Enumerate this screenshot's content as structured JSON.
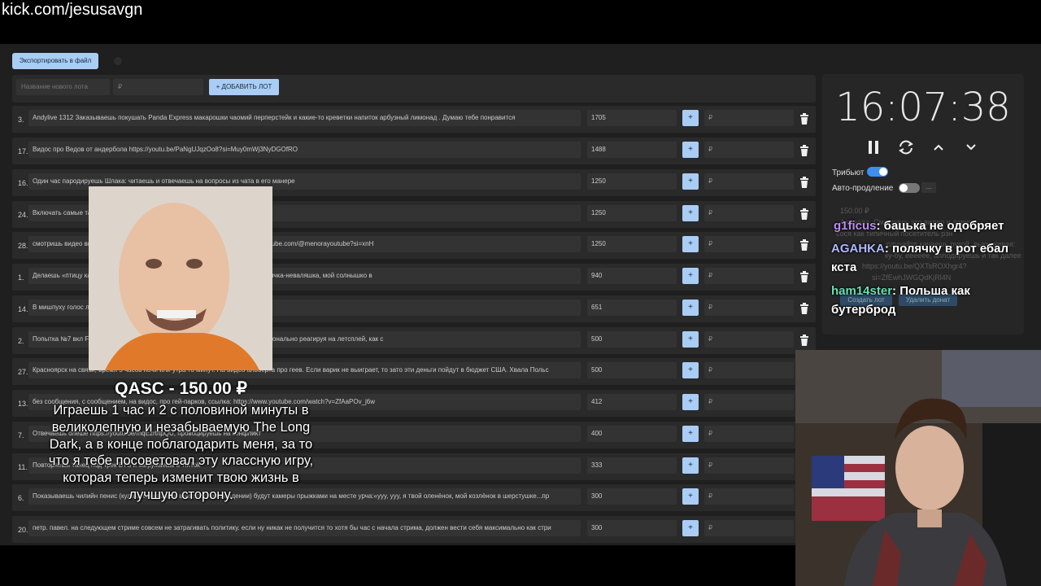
{
  "url": "kick.com/jesusavgn",
  "toolbar": {
    "export_label": "Экспортировать в файл"
  },
  "new_lot": {
    "name_placeholder": "Название нового лота",
    "amount_placeholder": "₽",
    "add_label": "+ ДОБАВИТЬ ЛОТ"
  },
  "currency": "₽",
  "lots": [
    {
      "num": "3.",
      "text": "Andylive 1312 Заказываешь покушать Panda Express макарошки чаомий перперстейк и какие-то креветки напиток арбузный лимонад . Думаю тебе понравится",
      "amount": "1705"
    },
    {
      "num": "17.",
      "text": "Видос про Ведов от андербола https://youtu.be/PaNgUJqzOo8?si=Muy0mWj3NyDGOfRO",
      "amount": "1488"
    },
    {
      "num": "16.",
      "text": "Один час пародируешь Шлака: читаешь и отвечаешь на вопросы из чата в его манере",
      "amount": "1250"
    },
    {
      "num": "24.",
      "text": "Включать самые танцевать и кайфовать",
      "amount": "1250"
    },
    {
      "num": "28.",
      "text": "смотришь видео видео если оно идет больше 30 минут. Вот ссылка https://youtube.com/@menorayoutube?si=xnH",
      "amount": "1250"
    },
    {
      "num": "1.",
      "text": "Делаешь «птицу камеры прыжками на месте чирикая: «Чирик чирик, я твоя птичка-неваляшка, мой солнышко в",
      "amount": "940"
    },
    {
      "num": "14.",
      "text": "В мишпуху голос любви",
      "amount": "651"
    },
    {
      "num": "2.",
      "text": "Попытка №7 вкл Flower со второго эпизода, смотри его до конца пятого, эмоционально реагируя на летсплей, как с",
      "amount": "500"
    },
    {
      "num": "27.",
      "text": "Красноярск на связи, время 5 часов ночи или утра то минут. На видео альберта про геев. Если варик не выиграет, то зато эти деньги пойдут в бюджет США. Хвала Польс",
      "amount": "500"
    },
    {
      "num": "13.",
      "text": "без сообщения, с сообщением, на видос, про гей-парков, ссылка: https://www.youtube.com/watch?v=ZfAaPOv_j6w",
      "amount": "412"
    },
    {
      "num": "7.",
      "text": "Отвечаешь олеше https://youtu.be/mqEzrtftpQU, провоцируешь на конфликт",
      "amount": "400"
    },
    {
      "num": "11.",
      "text": "Повторяешь танец под трек BTS и загружаешь в TikTok",
      "amount": "333"
    },
    {
      "num": "6.",
      "text": "Показываешь чилийн пенис (кулаки свенящими в час после выпадении) будут камеры прыжками на месте урча:«ууу, ууу, я твой оленёнок, мой козлёнок в шерстушке...пр",
      "amount": "300"
    },
    {
      "num": "20.",
      "text": "петр. павел. на следующем стриме совсем не затрагивать политику. если ну никак не получится то хотя бы час с начала стрима, должен вести себя максимально как стри",
      "amount": "300"
    }
  ],
  "timer": {
    "time": "16:07:38"
  },
  "toggles": {
    "tribute_label": "Трибьют",
    "auto_extend_label": "Авто-продление",
    "more_label": "..."
  },
  "chat_ghost": [
    "150.00 ₽",
    "Ааааааа. Смотришь это видео и давишь",
    "сося как типичный посетитель рзн",
    "случайте качаешь рукой, выкрикивая:",
    "ку-бу, ееееее, аплодируешь и так далее",
    "https://youtu.be/QXTsROXhgr4?",
    "si=ZfEwhJWGQdKjRl4N"
  ],
  "chat_buttons": {
    "create": "Создать лот",
    "delete": "Удалить донат"
  },
  "chat": [
    {
      "user": "g1ficus",
      "text": ": бацька не одобряет",
      "color": "#b98cf2"
    },
    {
      "user": "AGAHKA",
      "text": ": полячку в рот ебал кста",
      "color": "#b0b8ff"
    },
    {
      "user": "ham14ster",
      "text": ": Польша как бутерброд",
      "color": "#66e0b6"
    }
  ],
  "alert": {
    "title": "QASC - 150.00 ₽",
    "text": "Играешь 1 час и 2 с половиной минуты в великолепную и незабываемую The Long Dark, а в конце поблагодарить меня, за то что я тебе посоветовал эту классную игру, которая теперь изменит твою жизнь в лучшую сторону."
  },
  "colors": {
    "accent": "#a9cdf5",
    "toggle_on": "#3d8ef0",
    "bg": "#1f1f1f",
    "row": "#2a2a2a"
  }
}
